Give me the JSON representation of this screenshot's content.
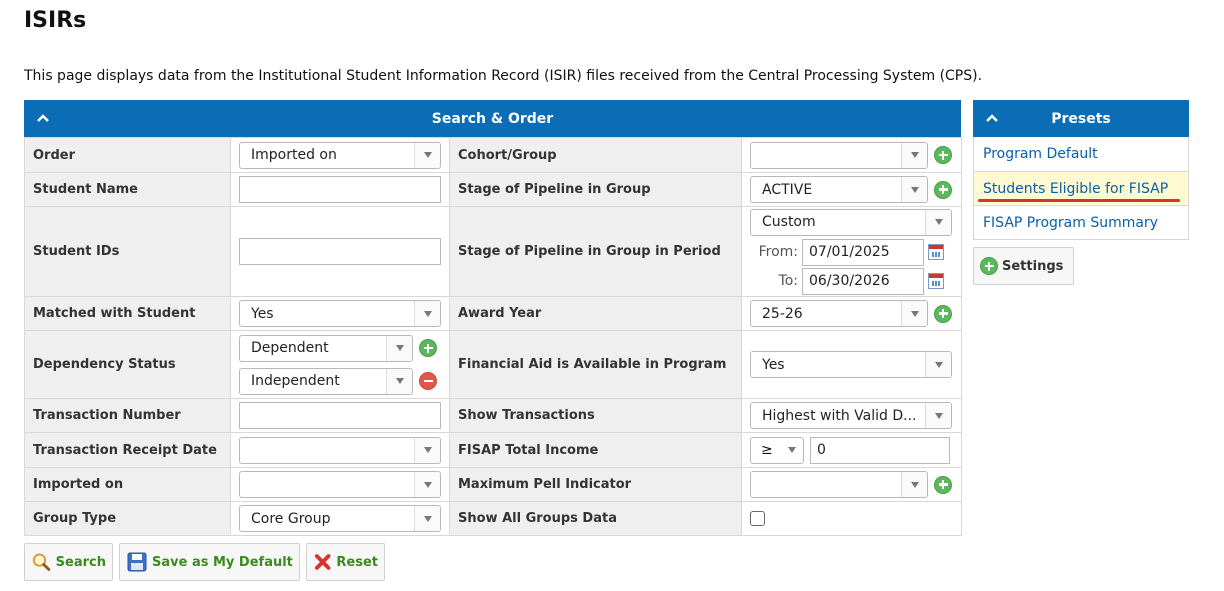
{
  "page": {
    "title": "ISIRs",
    "intro": "This page displays data from the Institutional Student Information Record (ISIR) files received from the Central Processing System (CPS)."
  },
  "search": {
    "header": "Search & Order",
    "labels": {
      "order": "Order",
      "student_name": "Student Name",
      "student_ids": "Student IDs",
      "matched_with_student": "Matched with Student",
      "dependency_status": "Dependency Status",
      "transaction_number": "Transaction Number",
      "transaction_receipt_date": "Transaction Receipt Date",
      "imported_on": "Imported on",
      "group_type": "Group Type",
      "cohort_group": "Cohort/Group",
      "stage_pipeline": "Stage of Pipeline in Group",
      "stage_pipeline_period": "Stage of Pipeline in Group in Period",
      "award_year": "Award Year",
      "financial_aid": "Financial Aid is Available in Program",
      "show_transactions": "Show Transactions",
      "fisap_total_income": "FISAP Total Income",
      "max_pell": "Maximum Pell Indicator",
      "show_all_groups": "Show All Groups Data"
    },
    "values": {
      "order": "Imported on",
      "student_name": "",
      "student_ids": "",
      "matched_with_student": "Yes",
      "dependency_1": "Dependent",
      "dependency_2": "Independent",
      "transaction_number": "",
      "transaction_receipt_date": "",
      "imported_on": "",
      "group_type": "Core Group",
      "cohort_group": "",
      "stage_pipeline": "ACTIVE",
      "stage_pipeline_period": "Custom",
      "from_label": "From:",
      "from_date": "07/01/2025",
      "to_label": "To:",
      "to_date": "06/30/2026",
      "award_year": "25-26",
      "financial_aid": "Yes",
      "show_transactions": "Highest with Valid D...",
      "fisap_operator": "≥",
      "fisap_value": "0",
      "max_pell": "",
      "show_all_groups": false
    }
  },
  "presets": {
    "header": "Presets",
    "items": [
      "Program Default",
      "Students Eligible for FISAP",
      "FISAP Program Summary"
    ],
    "active_index": 1,
    "settings_label": "Settings"
  },
  "actions": {
    "search": "Search",
    "save_default": "Save as My Default",
    "reset": "Reset"
  },
  "colors": {
    "header_blue": "#0a6db6",
    "link_blue": "#0a5ea8",
    "active_preset_bg": "#fffad1",
    "highlight_red": "#d9342b"
  }
}
